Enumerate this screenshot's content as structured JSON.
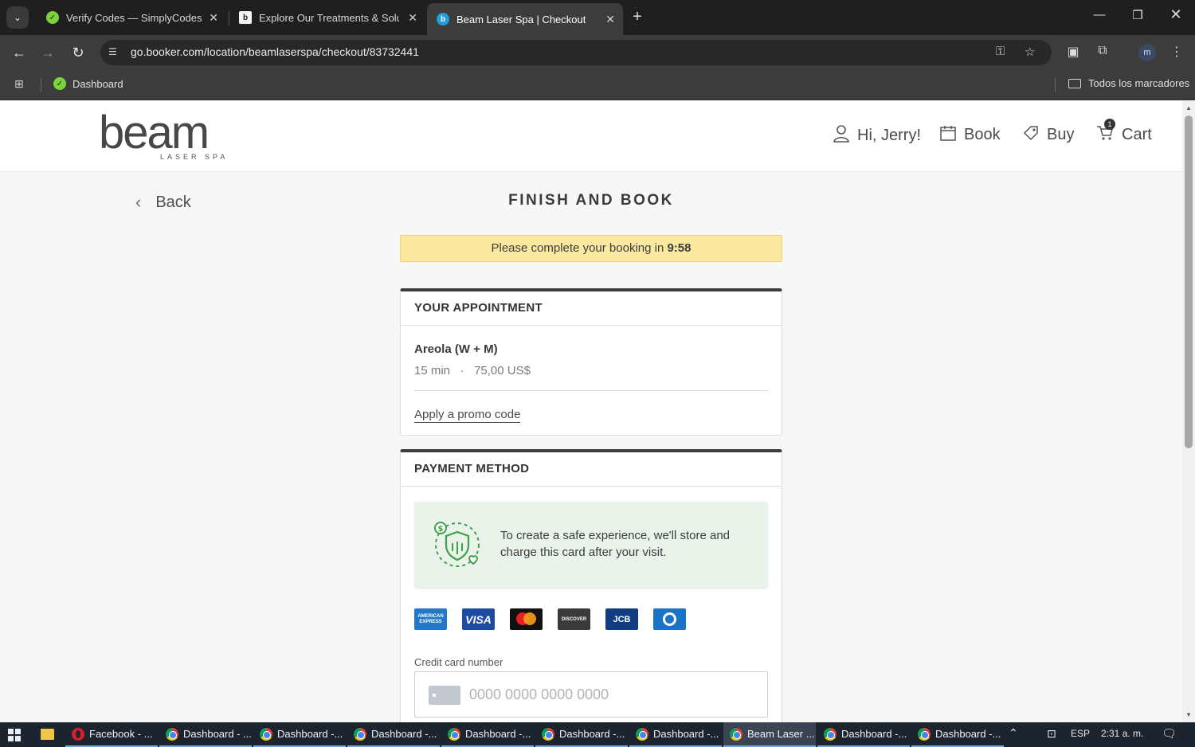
{
  "browser": {
    "tabs": [
      {
        "title": "Verify Codes — SimplyCodes",
        "active": false
      },
      {
        "title": "Explore Our Treatments & Solut",
        "active": false
      },
      {
        "title": "Beam Laser Spa | Checkout",
        "active": true
      }
    ],
    "url": "go.booker.com/location/beamlaserspa/checkout/83732441",
    "profile_initial": "m",
    "bookmarks": [
      {
        "label": "Dashboard"
      }
    ],
    "all_bookmarks_label": "Todos los marcadores"
  },
  "site": {
    "logo_word": "beam",
    "logo_sub": "LASER SPA",
    "nav": {
      "greeting": "Hi, Jerry!",
      "book": "Book",
      "buy": "Buy",
      "cart": "Cart",
      "cart_count": "1"
    }
  },
  "checkout": {
    "back_label": "Back",
    "title": "FINISH AND BOOK",
    "timer_text": "Please complete your booking in ",
    "timer_value": "9:58",
    "appointment": {
      "heading": "YOUR APPOINTMENT",
      "service": "Areola (W + M)",
      "duration": "15 min",
      "separator": "·",
      "price": "75,00 US$",
      "promo_link": "Apply a promo code"
    },
    "payment": {
      "heading": "PAYMENT METHOD",
      "safe_message": "To create a safe experience, we'll store and charge this card after your visit.",
      "card_brands": [
        {
          "name": "amex",
          "label": "AMERICAN EXPRESS"
        },
        {
          "name": "visa",
          "label": "VISA"
        },
        {
          "name": "mastercard",
          "label": ""
        },
        {
          "name": "discover",
          "label": "DISCOVER"
        },
        {
          "name": "jcb",
          "label": "JCB"
        },
        {
          "name": "diners",
          "label": ""
        }
      ],
      "cc_label": "Credit card number",
      "cc_placeholder": "0000 0000 0000 0000"
    }
  },
  "taskbar": {
    "tasks": [
      {
        "label": "Facebook - ...",
        "icon": "opera-icon"
      },
      {
        "label": "Dashboard - ...",
        "icon": "chrome-icon"
      },
      {
        "label": "Dashboard -...",
        "icon": "chrome-icon"
      },
      {
        "label": "Dashboard -...",
        "icon": "chrome-icon"
      },
      {
        "label": "Dashboard -...",
        "icon": "chrome-icon"
      },
      {
        "label": "Dashboard -...",
        "icon": "chrome-icon"
      },
      {
        "label": "Dashboard -...",
        "icon": "chrome-icon"
      },
      {
        "label": "Beam Laser ...",
        "icon": "chrome-icon"
      },
      {
        "label": "Dashboard -...",
        "icon": "chrome-icon"
      },
      {
        "label": "Dashboard -...",
        "icon": "chrome-icon"
      }
    ],
    "language": "ESP",
    "time": "2:31 a. m."
  },
  "colors": {
    "timer_bg": "#fbe9a0",
    "safe_bg": "#e9f3e9",
    "card_top_border": "#3d3d3d"
  }
}
